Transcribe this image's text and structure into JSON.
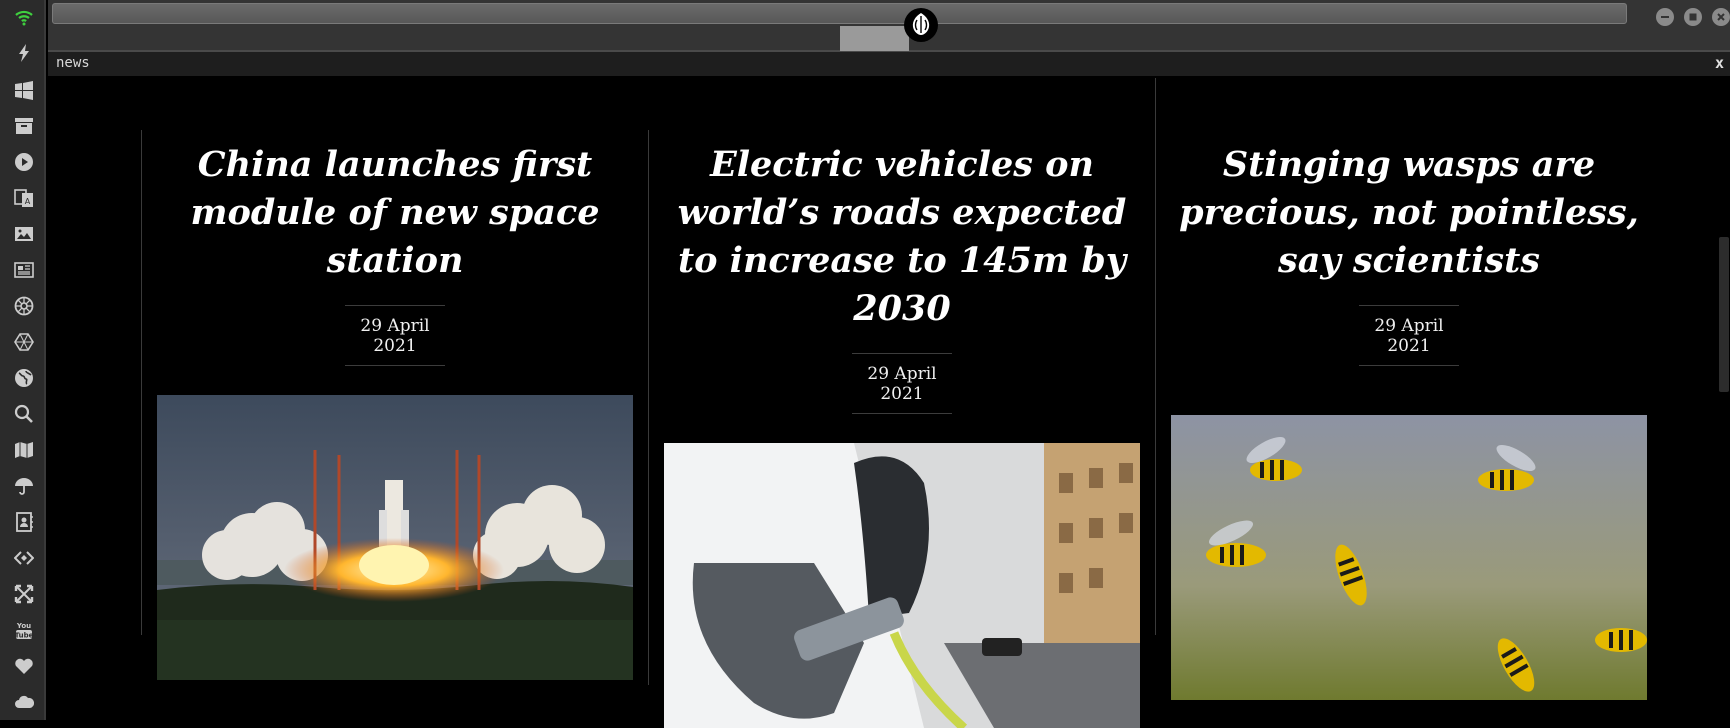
{
  "panel": {
    "title": "news",
    "close_label": "x"
  },
  "sidebar": {
    "items": [
      {
        "icon": "wifi-icon"
      },
      {
        "icon": "bolt-icon"
      },
      {
        "icon": "windows-icon"
      },
      {
        "icon": "archive-icon"
      },
      {
        "icon": "play-icon"
      },
      {
        "icon": "translate-icon"
      },
      {
        "icon": "image-icon"
      },
      {
        "icon": "newspaper-icon"
      },
      {
        "icon": "empire-icon"
      },
      {
        "icon": "hexagon-icon"
      },
      {
        "icon": "globe-icon"
      },
      {
        "icon": "search-icon"
      },
      {
        "icon": "map-icon"
      },
      {
        "icon": "umbrella-icon"
      },
      {
        "icon": "contacts-icon"
      },
      {
        "icon": "code-icon"
      },
      {
        "icon": "expand-icon"
      },
      {
        "icon": "youtube-icon"
      },
      {
        "icon": "heart-icon"
      },
      {
        "icon": "cloud-icon"
      }
    ]
  },
  "articles": [
    {
      "title": "China launches first module of new space station",
      "date": "29 April 2021",
      "image": "rocket-launch"
    },
    {
      "title": "Electric vehicles on world’s roads expected to increase to 145m by 2030",
      "date": "29 April 2021",
      "image": "ev-charging"
    },
    {
      "title": "Stinging wasps are precious, not pointless, say scientists",
      "date": "29 April 2021",
      "image": "wasps"
    }
  ],
  "colors": {
    "accent_wifi": "#3fcf3f",
    "sidebar": "#2b2b2b",
    "topbar": "#343434"
  }
}
